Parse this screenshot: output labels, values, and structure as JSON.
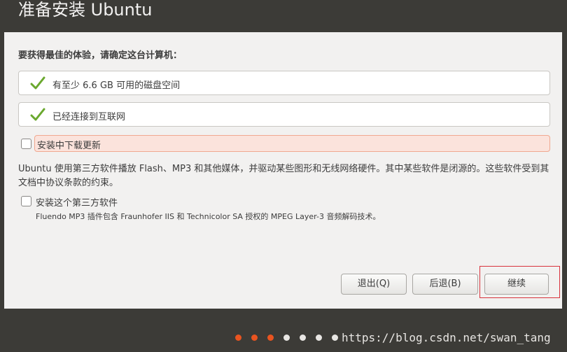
{
  "window": {
    "title": "准备安装 Ubuntu"
  },
  "question": "要获得最佳的体验，请确定这台计算机：",
  "requirements": [
    {
      "label": "有至少 6.6 GB 可用的磁盘空间",
      "icon": "checkmark-icon"
    },
    {
      "label": "已经连接到互联网",
      "icon": "checkmark-icon"
    }
  ],
  "options": {
    "updates": {
      "label": "安装中下载更新",
      "checked": false
    },
    "third_party": {
      "label": "安装这个第三方软件",
      "checked": false,
      "subtitle": "Fluendo MP3 插件包含 Fraunhofer IIS 和 Technicolor SA 授权的 MPEG Layer-3 音频解码技术。"
    }
  },
  "description": "Ubuntu 使用第三方软件播放 Flash、MP3 和其他媒体，并驱动某些图形和无线网络硬件。其中某些软件是闭源的。这些软件受到其文档中协议条款的约束。",
  "buttons": {
    "quit": "退出(Q)",
    "back": "后退(B)",
    "continue": "继续"
  },
  "progress": {
    "total_steps": 7,
    "completed_steps": 3
  },
  "watermark": "https://blog.csdn.net/swan_tang",
  "colors": {
    "accent_orange": "#e95420",
    "dot_inactive": "#e8e6e3",
    "check_green": "#6aa82e",
    "panel_bg": "#f2f1f0",
    "frame_bg": "#3c3b37"
  }
}
